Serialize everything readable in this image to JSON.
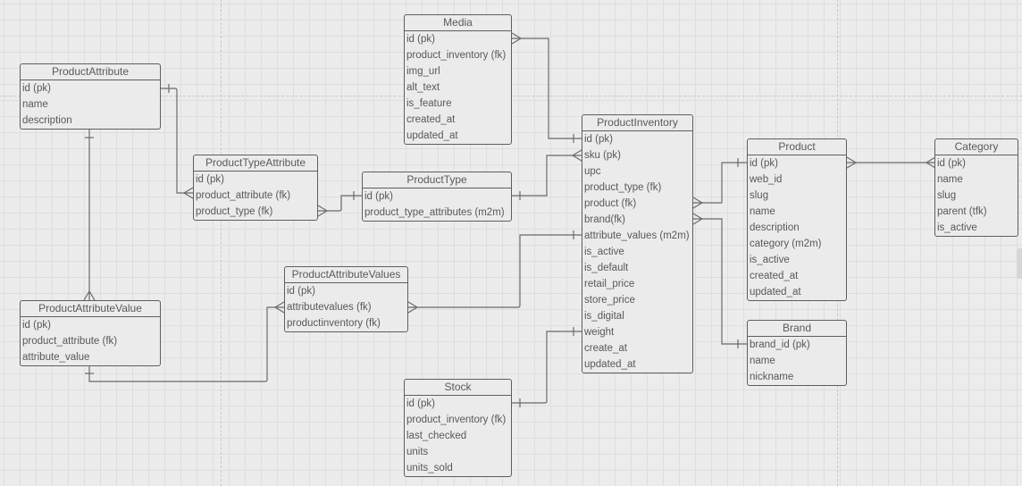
{
  "diagram": {
    "type": "entity-relationship",
    "entities": {
      "product_attribute": {
        "title": "ProductAttribute",
        "fields": [
          "id (pk)",
          "name",
          "description"
        ]
      },
      "product_type_attribute": {
        "title": "ProductTypeAttribute",
        "fields": [
          "id (pk)",
          "product_attribute (fk)",
          "product_type (fk)"
        ]
      },
      "product_type": {
        "title": "ProductType",
        "fields": [
          "id (pk)",
          "product_type_attributes (m2m)"
        ]
      },
      "media": {
        "title": "Media",
        "fields": [
          "id (pk)",
          "product_inventory (fk)",
          "img_url",
          "alt_text",
          "is_feature",
          "created_at",
          "updated_at"
        ]
      },
      "product_inventory": {
        "title": "ProductInventory",
        "fields": [
          "id (pk)",
          "sku (pk)",
          "upc",
          "product_type (fk)",
          "product (fk)",
          "brand(fk)",
          "attribute_values (m2m)",
          "is_active",
          "is_default",
          "retail_price",
          "store_price",
          "is_digital",
          "weight",
          "create_at",
          "updated_at"
        ]
      },
      "product": {
        "title": "Product",
        "fields": [
          "id (pk)",
          "web_id",
          "slug",
          "name",
          "description",
          "category (m2m)",
          "is_active",
          "created_at",
          "updated_at"
        ]
      },
      "category": {
        "title": "Category",
        "fields": [
          "id (pk)",
          "name",
          "slug",
          "parent (tfk)",
          "is_active"
        ]
      },
      "brand": {
        "title": "Brand",
        "fields": [
          "brand_id (pk)",
          "name",
          "nickname"
        ]
      },
      "product_attribute_value": {
        "title": "ProductAttributeValue",
        "fields": [
          "id (pk)",
          "product_attribute (fk)",
          "attribute_value"
        ]
      },
      "product_attribute_values": {
        "title": "ProductAttributeValues",
        "fields": [
          "id (pk)",
          "attributevalues (fk)",
          "productinventory (fk)"
        ]
      },
      "stock": {
        "title": "Stock",
        "fields": [
          "id (pk)",
          "product_inventory (fk)",
          "last_checked",
          "units",
          "units_sold"
        ]
      }
    },
    "relationships": [
      {
        "from": "ProductAttribute.id",
        "to": "ProductTypeAttribute.product_attribute",
        "cardinality": "one-to-many"
      },
      {
        "from": "ProductType.id",
        "to": "ProductTypeAttribute.product_type",
        "cardinality": "one-to-many"
      },
      {
        "from": "ProductType.id",
        "to": "ProductInventory.sku",
        "cardinality": "one-to-many"
      },
      {
        "from": "ProductInventory.id",
        "to": "Media.product_inventory",
        "cardinality": "one-to-many"
      },
      {
        "from": "Product.id",
        "to": "ProductInventory.product",
        "cardinality": "one-to-many"
      },
      {
        "from": "Brand.brand_id",
        "to": "ProductInventory.brand",
        "cardinality": "one-to-many"
      },
      {
        "from": "Category.id",
        "to": "Product.category",
        "cardinality": "many-to-many"
      },
      {
        "from": "ProductAttribute.id",
        "to": "ProductAttributeValue.product_attribute",
        "cardinality": "one-to-many"
      },
      {
        "from": "ProductAttributeValue.id",
        "to": "ProductAttributeValues.attributevalues",
        "cardinality": "one-to-many"
      },
      {
        "from": "ProductInventory.attribute_values",
        "to": "ProductAttributeValues.productinventory",
        "cardinality": "one-to-many"
      },
      {
        "from": "ProductInventory.weight",
        "to": "Stock.id",
        "cardinality": "one-to-one"
      }
    ]
  },
  "colors": {
    "canvas": "#ececec",
    "grid": "#dedede",
    "line": "#5e5e5e",
    "text": "#585858"
  }
}
